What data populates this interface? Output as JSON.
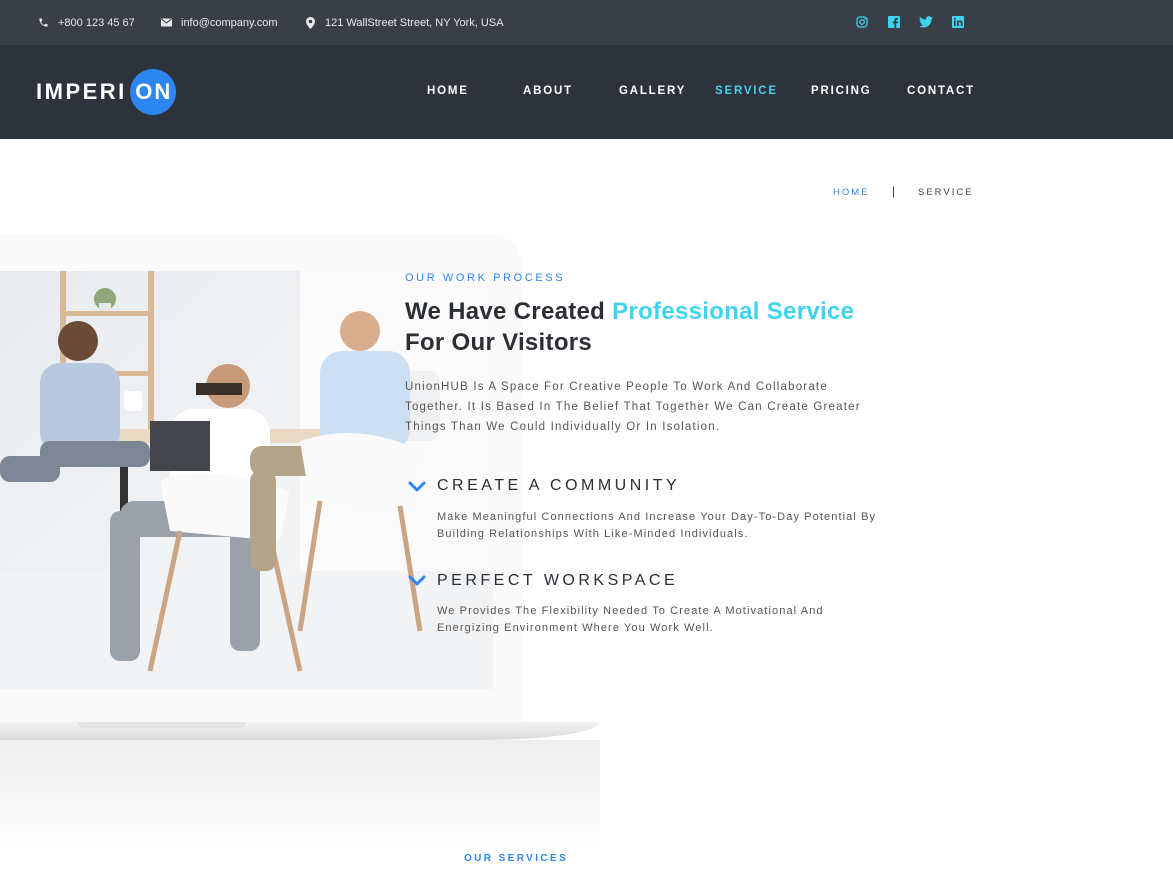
{
  "topbar": {
    "phone": "+800 123 45 67",
    "email": "info@company.com",
    "address": "121 WallStreet Street, NY York, USA",
    "social": [
      "instagram-icon",
      "facebook-icon",
      "twitter-icon",
      "linkedin-icon"
    ],
    "social_color": "#3fd3f0"
  },
  "header": {
    "logo_text": "IMPERI",
    "logo_badge": "ON",
    "nav": [
      {
        "label": "HOME",
        "active": false
      },
      {
        "label": "ABOUT",
        "active": false
      },
      {
        "label": "GALLERY",
        "active": false
      },
      {
        "label": "SERVICE",
        "active": true
      },
      {
        "label": "PRICING",
        "active": false
      },
      {
        "label": "CONTACT",
        "active": false
      }
    ]
  },
  "breadcrumb": {
    "home": "HOME",
    "separator": "|",
    "current": "SERVICE"
  },
  "process": {
    "kicker": "OUR WORK PROCESS",
    "title_start": "We Have Created",
    "title_highlight": "Professional Service",
    "title_end": "For Our Visitors",
    "intro": "UnionHUB Is A Space For Creative People To Work And Collaborate Together. It Is Based In The Belief That Together We Can Create Greater Things Than We Could Individually Or In Isolation.",
    "features": [
      {
        "title": "CREATE A COMMUNITY",
        "description": "Make Meaningful Connections And Increase Your Day-To-Day Potential By Building Relationships With Like-Minded Individuals."
      },
      {
        "title": "PERFECT WORKSPACE",
        "description": "We Provides The Flexibility Needed To Create A Motivational And Energizing Environment Where You Work Well."
      }
    ]
  },
  "services": {
    "kicker": "OUR SERVICES"
  },
  "colors": {
    "topbar_bg": "#3a3e46",
    "header_bg": "#2e323a",
    "brand_blue": "#2d86f0",
    "accent_cyan": "#3fd3f0",
    "heading": "#2b2e34"
  }
}
